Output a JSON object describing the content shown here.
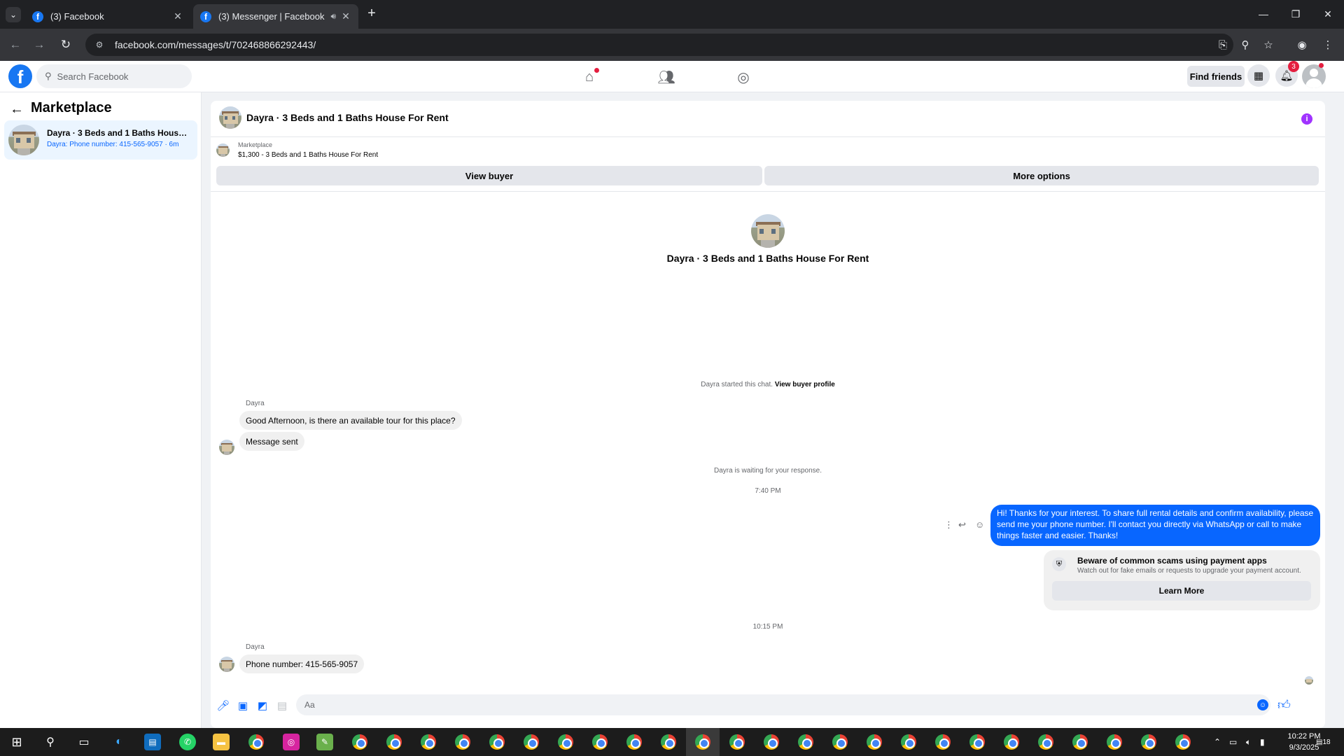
{
  "browser": {
    "tabs": [
      {
        "title": "(3) Facebook",
        "active": false
      },
      {
        "title": "(3) Messenger | Facebook",
        "active": true
      }
    ],
    "url": "facebook.com/messages/t/702468866292443/"
  },
  "fb_header": {
    "search_placeholder": "Search Facebook",
    "find_friends": "Find friends",
    "notification_count": "3"
  },
  "sidebar": {
    "title": "Marketplace",
    "conversation": {
      "title": "Dayra · 3 Beds and 1 Baths House For Rent",
      "subtitle": "Dayra: Phone number: 415-565-9057 · 6m"
    }
  },
  "chat": {
    "header_title": "Dayra · 3 Beds and 1 Baths House For Rent",
    "listing_category": "Marketplace",
    "listing_price": "$1,300 - 3 Beds and 1 Baths House For Rent",
    "view_buyer": "View buyer",
    "more_options": "More options",
    "center_title": "Dayra · 3 Beds and 1 Baths House For Rent",
    "started_text": "Dayra started this chat.",
    "view_buyer_profile": "View buyer profile",
    "sender_name": "Dayra",
    "msg1": "Good Afternoon, is there an available tour for this place?",
    "msg2": "Message sent",
    "waiting_text": "Dayra is waiting for your response.",
    "time1": "7:40 PM",
    "outgoing": "Hi! Thanks for your interest. To share full rental details and confirm availability, please send me your phone number. I'll contact you directly via WhatsApp or call to make things faster and easier. Thanks!",
    "scam_title": "Beware of common scams using payment apps",
    "scam_sub": "Watch out for fake emails or requests to upgrade your payment account.",
    "learn_more": "Learn More",
    "time2": "10:15 PM",
    "msg3": "Phone number: 415-565-9057",
    "composer_placeholder": "Aa"
  },
  "taskbar": {
    "time": "10:22 PM",
    "date": "9/3/2025",
    "notif_count": "18"
  }
}
